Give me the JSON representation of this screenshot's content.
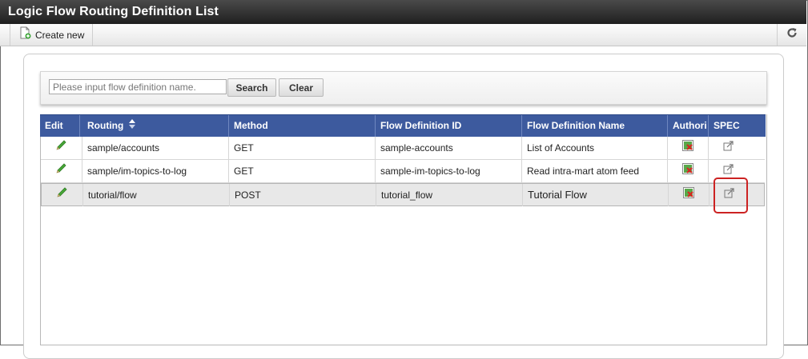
{
  "window": {
    "title": "Logic Flow Routing Definition List"
  },
  "toolbar": {
    "create_new_label": "Create new",
    "create_icon": "new-document-icon",
    "refresh_icon": "refresh-icon"
  },
  "search": {
    "placeholder": "Please input flow definition name.",
    "value": "",
    "search_label": "Search",
    "clear_label": "Clear"
  },
  "table": {
    "columns": [
      "Edit",
      "Routing",
      "Method",
      "Flow Definition ID",
      "Flow Definition Name",
      "Authori",
      "SPEC"
    ],
    "sort_icon": "sort-arrows-icon",
    "rows": [
      {
        "routing": "sample/accounts",
        "method": "GET",
        "flow_id": "sample-accounts",
        "flow_name": "List of Accounts"
      },
      {
        "routing": "sample/im-topics-to-log",
        "method": "GET",
        "flow_id": "sample-im-topics-to-log",
        "flow_name": "Read intra-mart atom feed"
      },
      {
        "routing": "tutorial/flow",
        "method": "POST",
        "flow_id": "tutorial_flow",
        "flow_name": "Tutorial Flow"
      }
    ],
    "selected_row": 2
  },
  "colors": {
    "header_bg": "#3d5a9e",
    "title_bg": "#2b2b2b",
    "highlight": "#cc2222",
    "edit_icon": "#3a9a2a"
  }
}
